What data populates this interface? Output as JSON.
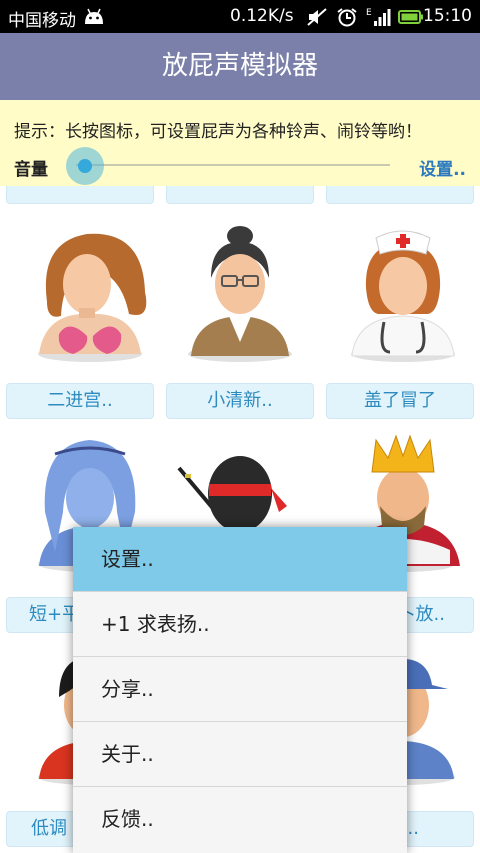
{
  "status_bar": {
    "carrier": "中国移动",
    "speed": "0.12K/s",
    "network": "E",
    "time": "15:10",
    "icons": [
      "android-icon",
      "mute-icon",
      "alarm-icon",
      "signal-icon",
      "battery-icon"
    ]
  },
  "app": {
    "title": "放屁声模拟器"
  },
  "tip": {
    "text": "提示：长按图标，可设置屁声为各种铃声、闹铃等哟！",
    "volume_label": "音量",
    "volume_level": 0.03,
    "settings_label": "设置.."
  },
  "grid": {
    "row2": [
      "二进宫..",
      "小清新..",
      "盖了冒了"
    ],
    "row3": [
      "短+平",
      "",
      "卜放.."
    ],
    "row4": [
      "低调",
      "",
      "稀.."
    ]
  },
  "menu": {
    "items": [
      "设置..",
      "+1 求表扬..",
      "分享..",
      "关于..",
      "反馈.."
    ]
  },
  "colors": {
    "title_bar": "#7b80aa",
    "tip_bg": "#fffcc8",
    "button_bg": "#e1f3fb",
    "button_text": "#2e8bbf",
    "menu_highlight": "#7ecae8"
  }
}
